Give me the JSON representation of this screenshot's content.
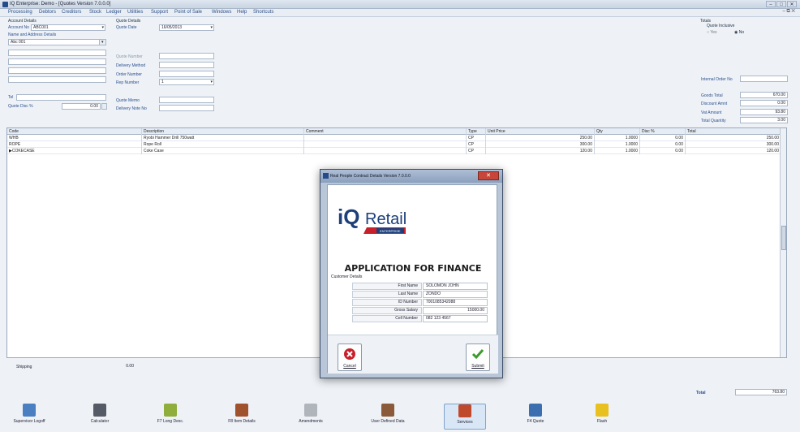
{
  "window": {
    "title": "IQ Enterprise: Demo - [Quotes Version 7.0.0.0]",
    "controls": [
      "–",
      "□",
      "✕"
    ]
  },
  "menu": {
    "items": [
      "Processing",
      "Debtors",
      "Creditors",
      "Stock",
      "Ledger",
      "Utilities",
      "Support",
      "Point of Sale",
      "Windows",
      "Help",
      "Shortcuts"
    ],
    "mdi_controls": "–  ⧉  ✕"
  },
  "account": {
    "section": "Account Details",
    "account_no_label": "Account No",
    "account_no": "ABC001",
    "name_addr_label": "Name and Address Details",
    "name": "Abc 001",
    "tel_label": "Tel",
    "quote_disc_label": "Quote Disc %",
    "quote_disc": "0.00"
  },
  "quote": {
    "section": "Quote Details",
    "date_label": "Quote Date",
    "date": "16/05/2013",
    "number_label": "Quote Number",
    "delivery_method_label": "Delivery Method",
    "order_number_label": "Order Number",
    "rep_number_label": "Rep Number",
    "rep_number": "1",
    "memo_label": "Quote Memo",
    "delivery_note_label": "Delivery Note No"
  },
  "totals": {
    "section": "Totals",
    "inclusive_label": "Quote Inclusive",
    "yes": "Yes",
    "no": "No",
    "internal_order_label": "Internal Order No",
    "goods_total_label": "Goods Total",
    "goods_total": "670.00",
    "discount_label": "Discount Amnt",
    "discount": "0.00",
    "vat_label": "Vat Amount",
    "vat": "93.80",
    "qty_label": "Total Quantity",
    "qty": "3.00"
  },
  "grid": {
    "columns": [
      "Code",
      "Description",
      "Comment",
      "Type",
      "Unit Price",
      "Qty",
      "Disc %",
      "Total"
    ],
    "rows": [
      {
        "code": "WHB",
        "description": "Ryobi Hammer Drill 750watt",
        "comment": "",
        "type": "CP",
        "price": "250.00",
        "qty": "1.0000",
        "disc": "0.00",
        "total": "250.00"
      },
      {
        "code": "ROPE",
        "description": "Rope Roll",
        "comment": "",
        "type": "CP",
        "price": "300.00",
        "qty": "1.0000",
        "disc": "0.00",
        "total": "300.00"
      },
      {
        "code": "COKECASE",
        "description": "Coke Case",
        "comment": "",
        "type": "CP",
        "price": "120.00",
        "qty": "1.0000",
        "disc": "0.00",
        "total": "120.00"
      }
    ]
  },
  "footer": {
    "shipping_label": "Shipping",
    "shipping": "0.00",
    "total_label": "Total",
    "total": "763.80"
  },
  "toolbar": [
    {
      "label": "Supervisor Logoff",
      "icon": "supervisor-icon",
      "color": "#4a7fc1"
    },
    {
      "label": "Calculator",
      "icon": "calculator-icon",
      "color": "#555b66"
    },
    {
      "label": "F7 Long Desc.",
      "icon": "long-desc-icon",
      "color": "#8fae3c"
    },
    {
      "label": "F8 Item Details",
      "icon": "item-details-icon",
      "color": "#a0522d"
    },
    {
      "label": "Amendments",
      "icon": "amendments-icon",
      "color": "#b0b4bb"
    },
    {
      "label": "User Defined Data",
      "icon": "user-data-icon",
      "color": "#8a5a3a"
    },
    {
      "label": "Services",
      "icon": "services-icon",
      "color": "#c0492b"
    },
    {
      "label": "F4 Quote",
      "icon": "quote-icon",
      "color": "#3c6fb0"
    },
    {
      "label": "Flash",
      "icon": "flash-icon",
      "color": "#e8c020"
    }
  ],
  "dialog": {
    "title": "Real People Contract Details Version 7.0.0.0",
    "close": "✕",
    "logo_text": "iQRetail",
    "logo_sub": "ENTERPRISE",
    "heading": "APPLICATION FOR FINANCE",
    "customer_details": "Customer Details",
    "fields": [
      {
        "label": "First Name",
        "value": "SOLOMON JOHN"
      },
      {
        "label": "Last Name",
        "value": "ZONDO"
      },
      {
        "label": "ID Number",
        "value": "7001085342088"
      },
      {
        "label": "Gross Salary",
        "value": "15000.00"
      },
      {
        "label": "Cell Number",
        "value": "082 123 4567"
      }
    ],
    "cancel": "Cancel",
    "submit": "Submit"
  }
}
